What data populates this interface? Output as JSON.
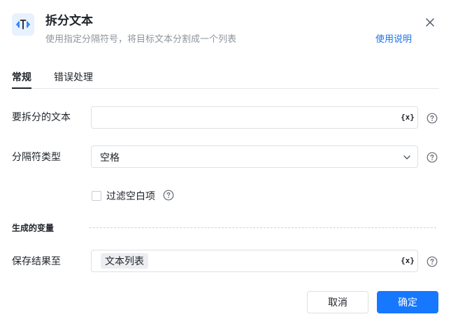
{
  "dialog": {
    "icon": "text-split-icon",
    "title": "拆分文本",
    "subtitle": "使用指定分隔符号，将目标文本分割成一个列表",
    "help_link": "使用说明",
    "close_icon": "close-icon"
  },
  "tabs": [
    {
      "label": "常规",
      "active": true
    },
    {
      "label": "错误处理",
      "active": false
    }
  ],
  "form": {
    "text_to_split": {
      "label": "要拆分的文本",
      "value": "",
      "var_icon_text": "{x}"
    },
    "separator_type": {
      "label": "分隔符类型",
      "value": "空格"
    },
    "filter_empty": {
      "label": "过滤空白项",
      "checked": false
    },
    "output_section": {
      "title": "生成的变量"
    },
    "save_to": {
      "label": "保存结果至",
      "value": "文本列表",
      "var_icon_text": "{x}"
    }
  },
  "footer": {
    "cancel_label": "取消",
    "ok_label": "确定"
  },
  "colors": {
    "accent": "#1677ff",
    "link": "#1a73e8",
    "icon_bg": "#e8f1fe"
  }
}
